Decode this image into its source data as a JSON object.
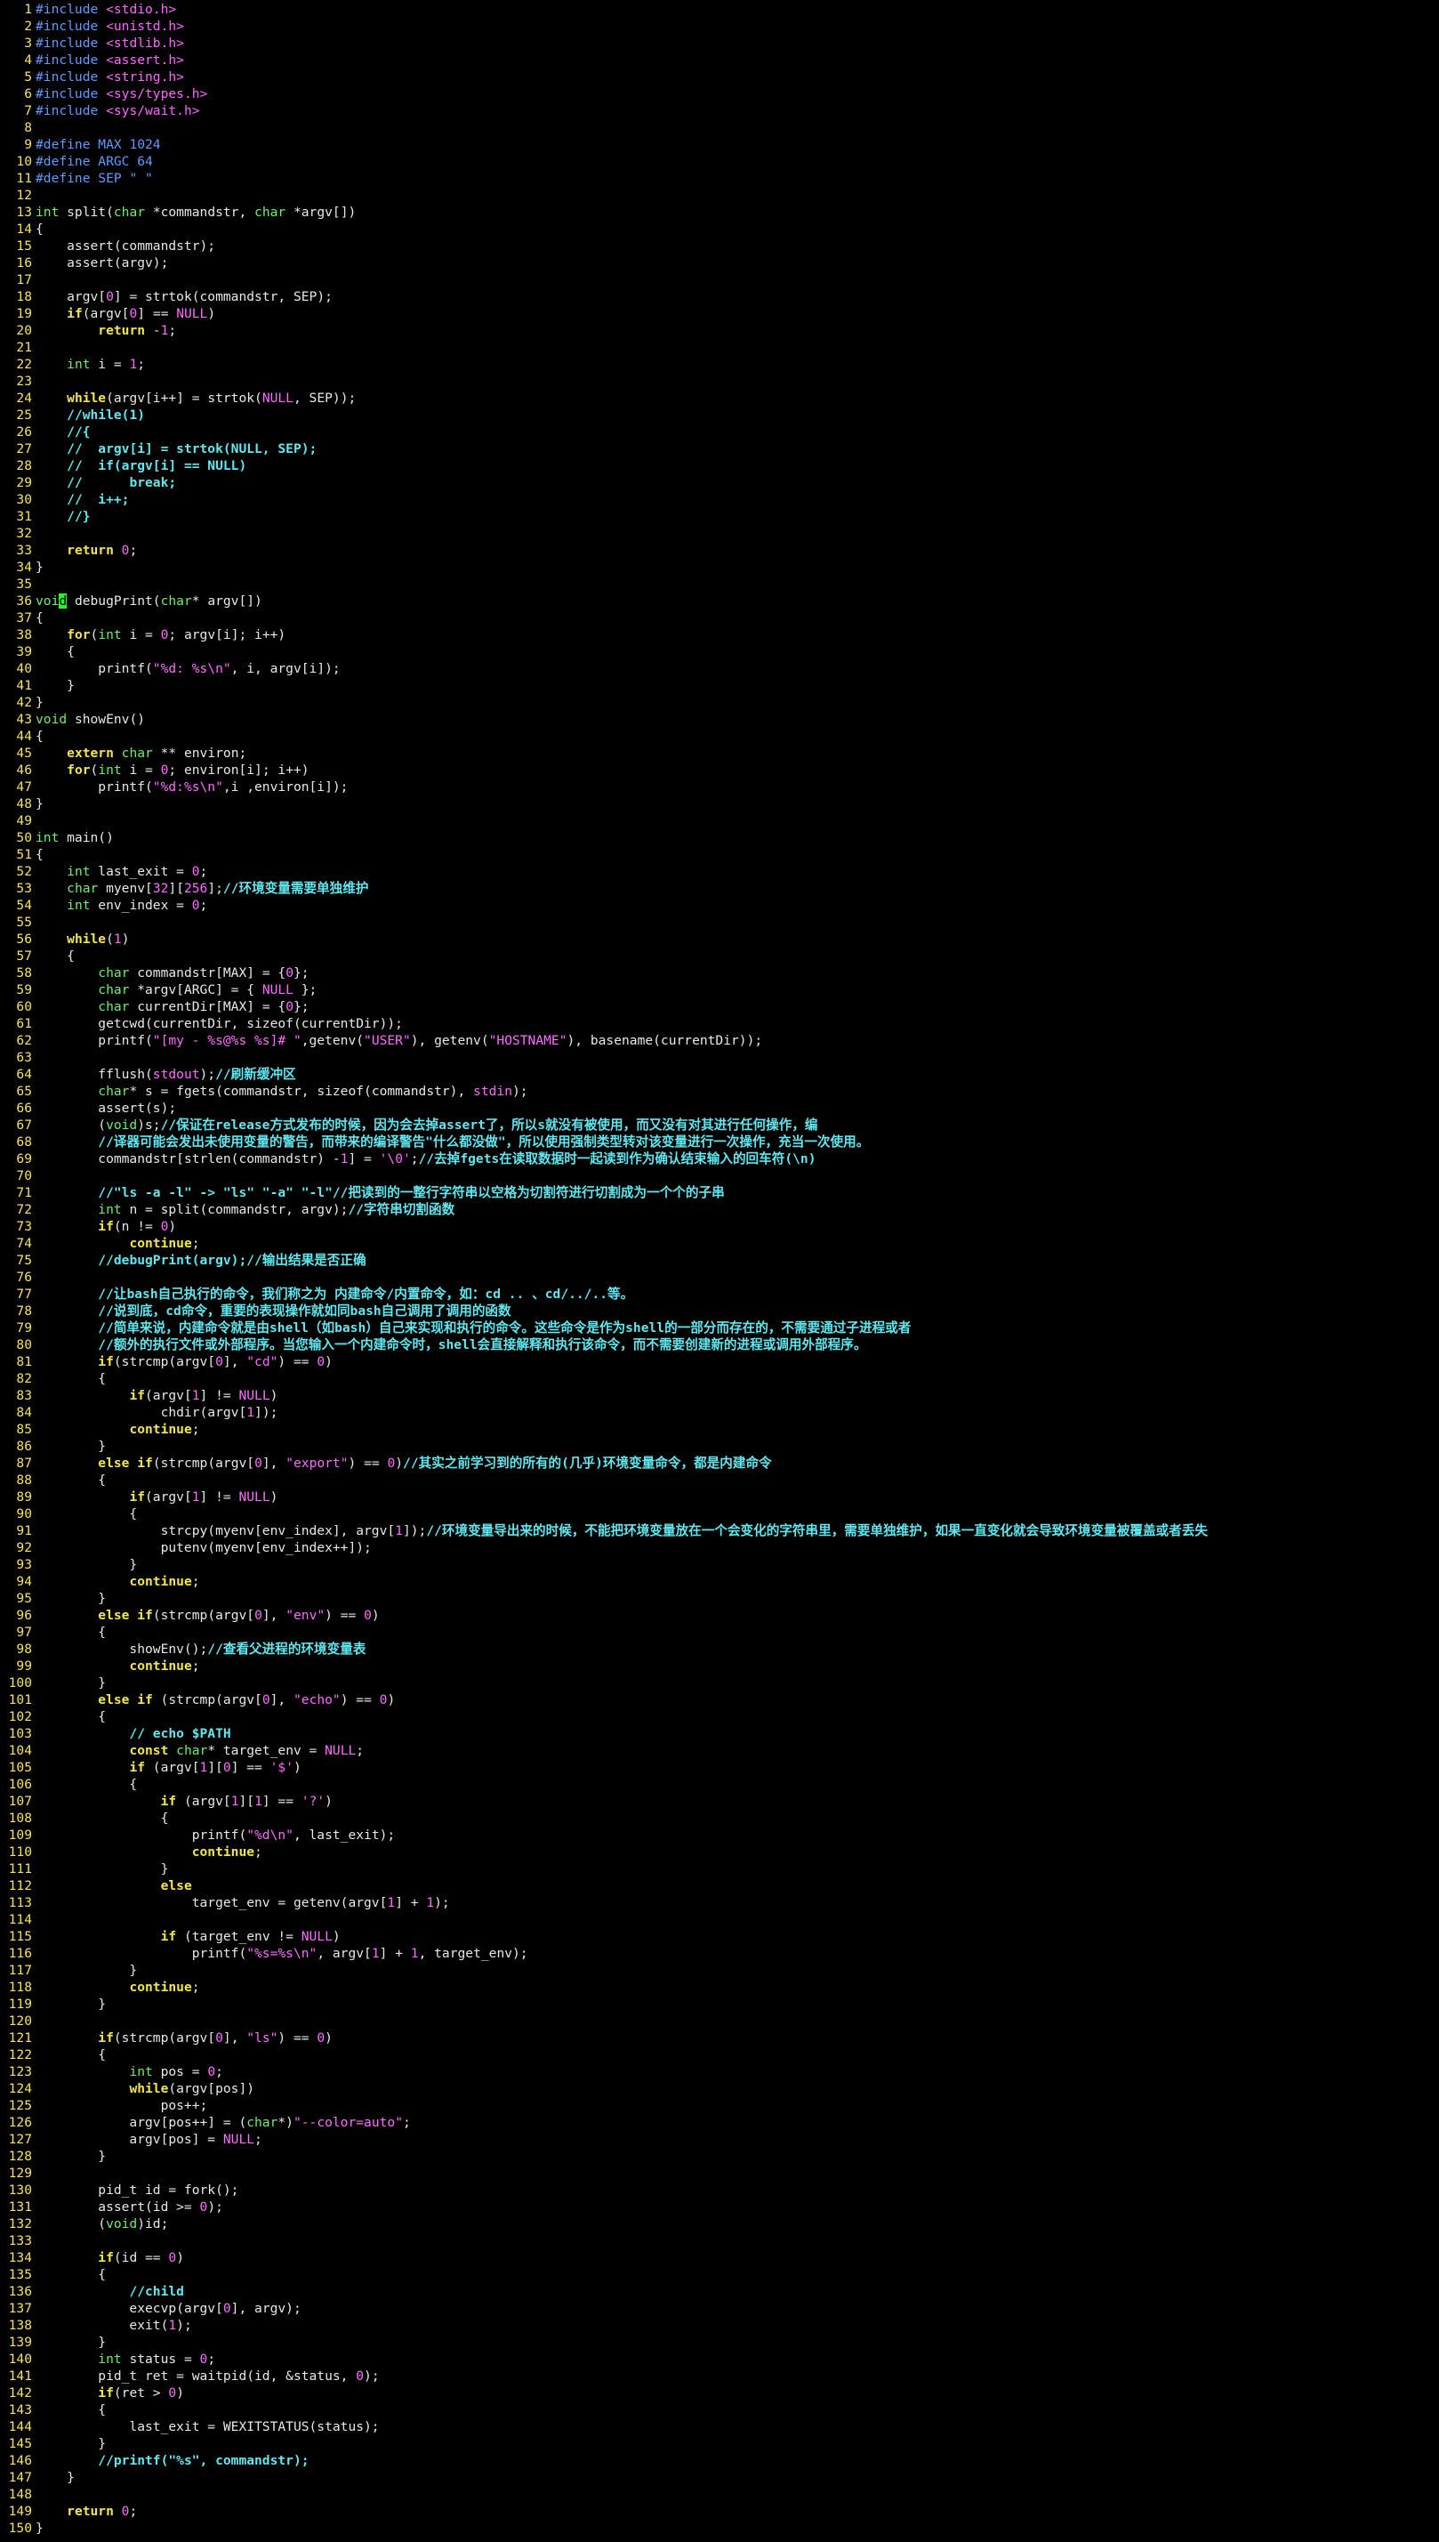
{
  "editor": {
    "cursor": {
      "line": 36,
      "col": 3
    },
    "lines": [
      "#include <stdio.h>",
      "#include <unistd.h>",
      "#include <stdlib.h>",
      "#include <assert.h>",
      "#include <string.h>",
      "#include <sys/types.h>",
      "#include <sys/wait.h>",
      "",
      "#define MAX 1024",
      "#define ARGC 64",
      "#define SEP \" \"",
      "",
      "int split(char *commandstr, char *argv[])",
      "{",
      "    assert(commandstr);",
      "    assert(argv);",
      "",
      "    argv[0] = strtok(commandstr, SEP);",
      "    if(argv[0] == NULL)",
      "        return -1;",
      "",
      "    int i = 1;",
      "",
      "    while(argv[i++] = strtok(NULL, SEP));",
      "    //while(1)",
      "    //{",
      "    //  argv[i] = strtok(NULL, SEP);",
      "    //  if(argv[i] == NULL)",
      "    //      break;",
      "    //  i++;",
      "    //}",
      "",
      "    return 0;",
      "}",
      "",
      "void debugPrint(char* argv[])",
      "{",
      "    for(int i = 0; argv[i]; i++)",
      "    {",
      "        printf(\"%d: %s\\n\", i, argv[i]);",
      "    }",
      "}",
      "void showEnv()",
      "{",
      "    extern char ** environ;",
      "    for(int i = 0; environ[i]; i++)",
      "        printf(\"%d:%s\\n\",i ,environ[i]);",
      "}",
      "",
      "int main()",
      "{",
      "    int last_exit = 0;",
      "    char myenv[32][256];//环境变量需要单独维护",
      "    int env_index = 0;",
      "",
      "    while(1)",
      "    {",
      "        char commandstr[MAX] = {0};",
      "        char *argv[ARGC] = { NULL };",
      "        char currentDir[MAX] = {0};",
      "        getcwd(currentDir, sizeof(currentDir));",
      "        printf(\"[my - %s@%s %s]# \",getenv(\"USER\"), getenv(\"HOSTNAME\"), basename(currentDir));",
      "",
      "        fflush(stdout);//刷新缓冲区",
      "        char* s = fgets(commandstr, sizeof(commandstr), stdin);",
      "        assert(s);",
      "        (void)s;//保证在release方式发布的时候，因为会去掉assert了，所以s就没有被使用，而又没有对其进行任何操作，编",
      "        //译器可能会发出未使用变量的警告，而带来的编译警告\"什么都没做\"，所以使用强制类型转对该变量进行一次操作，充当一次使用。",
      "        commandstr[strlen(commandstr) -1] = '\\0';//去掉fgets在读取数据时一起读到作为确认结束输入的回车符(\\n)",
      "",
      "        //\"ls -a -l\" -> \"ls\" \"-a\" \"-l\"//把读到的一整行字符串以空格为切割符进行切割成为一个个的子串",
      "        int n = split(commandstr, argv);//字符串切割函数",
      "        if(n != 0)",
      "            continue;",
      "        //debugPrint(argv);//输出结果是否正确",
      "",
      "        //让bash自己执行的命令，我们称之为 内建命令/内置命令，如：cd .. 、cd/../..等。",
      "        //说到底，cd命令，重要的表现操作就如同bash自己调用了调用的函数",
      "        //简单来说，内建命令就是由shell（如bash）自己来实现和执行的命令。这些命令是作为shell的一部分而存在的，不需要通过子进程或者",
      "        //额外的执行文件或外部程序。当您输入一个内建命令时，shell会直接解释和执行该命令，而不需要创建新的进程或调用外部程序。",
      "        if(strcmp(argv[0], \"cd\") == 0)",
      "        {",
      "            if(argv[1] != NULL)",
      "                chdir(argv[1]);",
      "            continue;",
      "        }",
      "        else if(strcmp(argv[0], \"export\") == 0)//其实之前学习到的所有的(几乎)环境变量命令，都是内建命令",
      "        {",
      "            if(argv[1] != NULL)",
      "            {",
      "                strcpy(myenv[env_index], argv[1]);//环境变量导出来的时候，不能把环境变量放在一个会变化的字符串里，需要单独维护，如果一直变化就会导致环境变量被覆盖或者丢失",
      "                putenv(myenv[env_index++]);",
      "            }",
      "            continue;",
      "        }",
      "        else if(strcmp(argv[0], \"env\") == 0)",
      "        {",
      "            showEnv();//查看父进程的环境变量表",
      "            continue;",
      "        }",
      "        else if (strcmp(argv[0], \"echo\") == 0)",
      "        {",
      "            // echo $PATH",
      "            const char* target_env = NULL;",
      "            if (argv[1][0] == '$')",
      "            {",
      "                if (argv[1][1] == '?')",
      "                {",
      "                    printf(\"%d\\n\", last_exit);",
      "                    continue;",
      "                }",
      "                else",
      "                    target_env = getenv(argv[1] + 1);",
      "",
      "                if (target_env != NULL)",
      "                    printf(\"%s=%s\\n\", argv[1] + 1, target_env);",
      "            }",
      "            continue;",
      "        }",
      "",
      "        if(strcmp(argv[0], \"ls\") == 0)",
      "        {",
      "            int pos = 0;",
      "            while(argv[pos])",
      "                pos++;",
      "            argv[pos++] = (char*)\"--color=auto\";",
      "            argv[pos] = NULL;",
      "        }",
      "",
      "        pid_t id = fork();",
      "        assert(id >= 0);",
      "        (void)id;",
      "",
      "        if(id == 0)",
      "        {",
      "            //child",
      "            execvp(argv[0], argv);",
      "            exit(1);",
      "        }",
      "        int status = 0;",
      "        pid_t ret = waitpid(id, &status, 0);",
      "        if(ret > 0)",
      "        {",
      "            last_exit = WEXITSTATUS(status);",
      "        }",
      "        //printf(\"%s\", commandstr);",
      "    }",
      "",
      "    return 0;",
      "}"
    ]
  },
  "colors": {
    "background": "#000000",
    "line_number": "#f7e25a",
    "preprocessor": "#5f9cff",
    "keyword": "#f2e64a",
    "type": "#6cf06c",
    "string": "#ff6bff",
    "comment": "#5fe8f0",
    "cursor": "#22ff22"
  }
}
